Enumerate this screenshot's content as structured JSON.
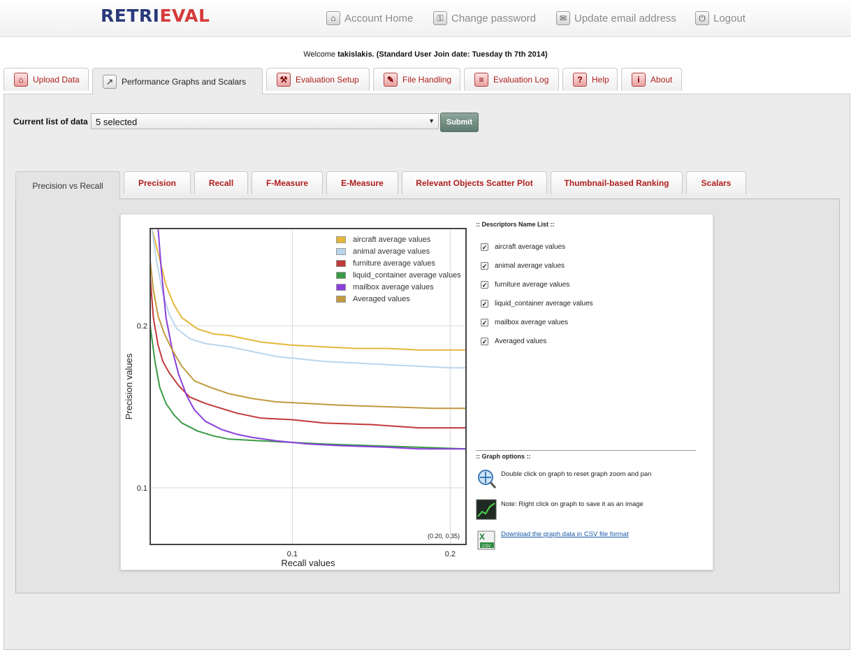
{
  "header": {
    "logo_part1": "RETRI",
    "logo_part2": "EVAL",
    "nav": [
      {
        "label": "Account Home",
        "icon": "home-icon"
      },
      {
        "label": "Change password",
        "icon": "key-icon"
      },
      {
        "label": "Update email address",
        "icon": "envelope-icon"
      },
      {
        "label": "Logout",
        "icon": "power-icon"
      }
    ]
  },
  "welcome": {
    "prefix": "Welcome ",
    "user": "takislakis.",
    "info": " (Standard User Join date: Tuesday th 7th 2014)"
  },
  "main_tabs": [
    {
      "label": "Upload Data",
      "icon": "upload-home-icon"
    },
    {
      "label": "Performance Graphs and Scalars",
      "icon": "graph-icon"
    },
    {
      "label": "Evaluation Setup",
      "icon": "wrench-icon"
    },
    {
      "label": "File Handling",
      "icon": "file-edit-icon"
    },
    {
      "label": "Evaluation Log",
      "icon": "log-list-icon"
    },
    {
      "label": "Help",
      "icon": "question-icon"
    },
    {
      "label": "About",
      "icon": "info-icon"
    }
  ],
  "data_select": {
    "label": "Current list of data :",
    "value": "5 selected",
    "submit": "Submit"
  },
  "sub_tabs": [
    "Precision vs Recall",
    "Precision",
    "Recall",
    "F-Measure",
    "E-Measure",
    "Relevant Objects Scatter Plot",
    "Thumbnail-based Ranking",
    "Scalars"
  ],
  "chart_data": {
    "type": "line",
    "xlabel": "Recall values",
    "ylabel": "Precision values",
    "xlim": [
      0.01,
      0.21
    ],
    "ylim": [
      0.065,
      0.26
    ],
    "x_ticks": [
      {
        "v": 0.1,
        "label": "0.1"
      },
      {
        "v": 0.2,
        "label": "0.2"
      }
    ],
    "y_ticks": [
      {
        "v": 0.1,
        "label": "0.1"
      },
      {
        "v": 0.2,
        "label": "0.2"
      }
    ],
    "grid": true,
    "legend_position": "top-right",
    "coords_readout": "(0.20, 0.35)",
    "series": [
      {
        "name": "aircraft average values",
        "color": "#e5b73b",
        "points": [
          [
            0.011,
            0.26
          ],
          [
            0.015,
            0.245
          ],
          [
            0.02,
            0.225
          ],
          [
            0.025,
            0.213
          ],
          [
            0.03,
            0.205
          ],
          [
            0.04,
            0.198
          ],
          [
            0.05,
            0.195
          ],
          [
            0.06,
            0.194
          ],
          [
            0.07,
            0.192
          ],
          [
            0.08,
            0.19
          ],
          [
            0.09,
            0.189
          ],
          [
            0.1,
            0.188
          ],
          [
            0.12,
            0.187
          ],
          [
            0.14,
            0.186
          ],
          [
            0.16,
            0.186
          ],
          [
            0.18,
            0.185
          ],
          [
            0.2,
            0.185
          ],
          [
            0.21,
            0.185
          ]
        ]
      },
      {
        "name": "animal average values",
        "color": "#b9d5ec",
        "points": [
          [
            0.011,
            0.26
          ],
          [
            0.014,
            0.24
          ],
          [
            0.018,
            0.22
          ],
          [
            0.022,
            0.207
          ],
          [
            0.027,
            0.198
          ],
          [
            0.035,
            0.192
          ],
          [
            0.045,
            0.189
          ],
          [
            0.06,
            0.187
          ],
          [
            0.07,
            0.185
          ],
          [
            0.08,
            0.183
          ],
          [
            0.09,
            0.181
          ],
          [
            0.1,
            0.18
          ],
          [
            0.12,
            0.178
          ],
          [
            0.14,
            0.177
          ],
          [
            0.16,
            0.176
          ],
          [
            0.18,
            0.175
          ],
          [
            0.2,
            0.174
          ],
          [
            0.21,
            0.174
          ]
        ]
      },
      {
        "name": "furniture average values",
        "color": "#c0393b",
        "points": [
          [
            0.008,
            0.26
          ],
          [
            0.01,
            0.23
          ],
          [
            0.012,
            0.205
          ],
          [
            0.015,
            0.188
          ],
          [
            0.018,
            0.178
          ],
          [
            0.022,
            0.171
          ],
          [
            0.028,
            0.163
          ],
          [
            0.035,
            0.156
          ],
          [
            0.045,
            0.152
          ],
          [
            0.055,
            0.149
          ],
          [
            0.065,
            0.146
          ],
          [
            0.08,
            0.143
          ],
          [
            0.1,
            0.142
          ],
          [
            0.12,
            0.14
          ],
          [
            0.15,
            0.139
          ],
          [
            0.18,
            0.137
          ],
          [
            0.21,
            0.137
          ]
        ]
      },
      {
        "name": "liquid_container average values",
        "color": "#3a9a45",
        "points": [
          [
            0.006,
            0.26
          ],
          [
            0.008,
            0.23
          ],
          [
            0.01,
            0.2
          ],
          [
            0.013,
            0.178
          ],
          [
            0.016,
            0.162
          ],
          [
            0.02,
            0.152
          ],
          [
            0.025,
            0.145
          ],
          [
            0.03,
            0.14
          ],
          [
            0.04,
            0.135
          ],
          [
            0.05,
            0.132
          ],
          [
            0.06,
            0.13
          ],
          [
            0.08,
            0.129
          ],
          [
            0.1,
            0.128
          ],
          [
            0.12,
            0.127
          ],
          [
            0.15,
            0.126
          ],
          [
            0.18,
            0.125
          ],
          [
            0.21,
            0.124
          ]
        ]
      },
      {
        "name": "mailbox average values",
        "color": "#8a3fdc",
        "points": [
          [
            0.015,
            0.26
          ],
          [
            0.017,
            0.235
          ],
          [
            0.02,
            0.205
          ],
          [
            0.024,
            0.185
          ],
          [
            0.028,
            0.17
          ],
          [
            0.033,
            0.157
          ],
          [
            0.038,
            0.148
          ],
          [
            0.045,
            0.141
          ],
          [
            0.055,
            0.136
          ],
          [
            0.065,
            0.133
          ],
          [
            0.075,
            0.131
          ],
          [
            0.09,
            0.129
          ],
          [
            0.11,
            0.127
          ],
          [
            0.13,
            0.126
          ],
          [
            0.16,
            0.125
          ],
          [
            0.18,
            0.124
          ],
          [
            0.21,
            0.124
          ]
        ]
      },
      {
        "name": "Averaged values",
        "color": "#c09a3e",
        "points": [
          [
            0.008,
            0.26
          ],
          [
            0.01,
            0.24
          ],
          [
            0.012,
            0.222
          ],
          [
            0.015,
            0.206
          ],
          [
            0.019,
            0.195
          ],
          [
            0.024,
            0.185
          ],
          [
            0.03,
            0.175
          ],
          [
            0.038,
            0.166
          ],
          [
            0.048,
            0.162
          ],
          [
            0.06,
            0.158
          ],
          [
            0.075,
            0.155
          ],
          [
            0.09,
            0.153
          ],
          [
            0.11,
            0.152
          ],
          [
            0.13,
            0.151
          ],
          [
            0.16,
            0.15
          ],
          [
            0.19,
            0.149
          ],
          [
            0.21,
            0.149
          ]
        ]
      }
    ]
  },
  "descriptors": {
    "title": ":: Descriptors Name List ::",
    "items": [
      "aircraft average values",
      "animal average values",
      "furniture average values",
      "liquid_container average values",
      "mailbox average values",
      "Averaged values"
    ]
  },
  "graph_options": {
    "title": ":: Graph options ::",
    "zoom_note": "Double click on graph to reset graph zoom and pan",
    "save_note": "Note: Right click on graph to save it as an image",
    "csv_link": "Download the graph data in CSV file format"
  }
}
